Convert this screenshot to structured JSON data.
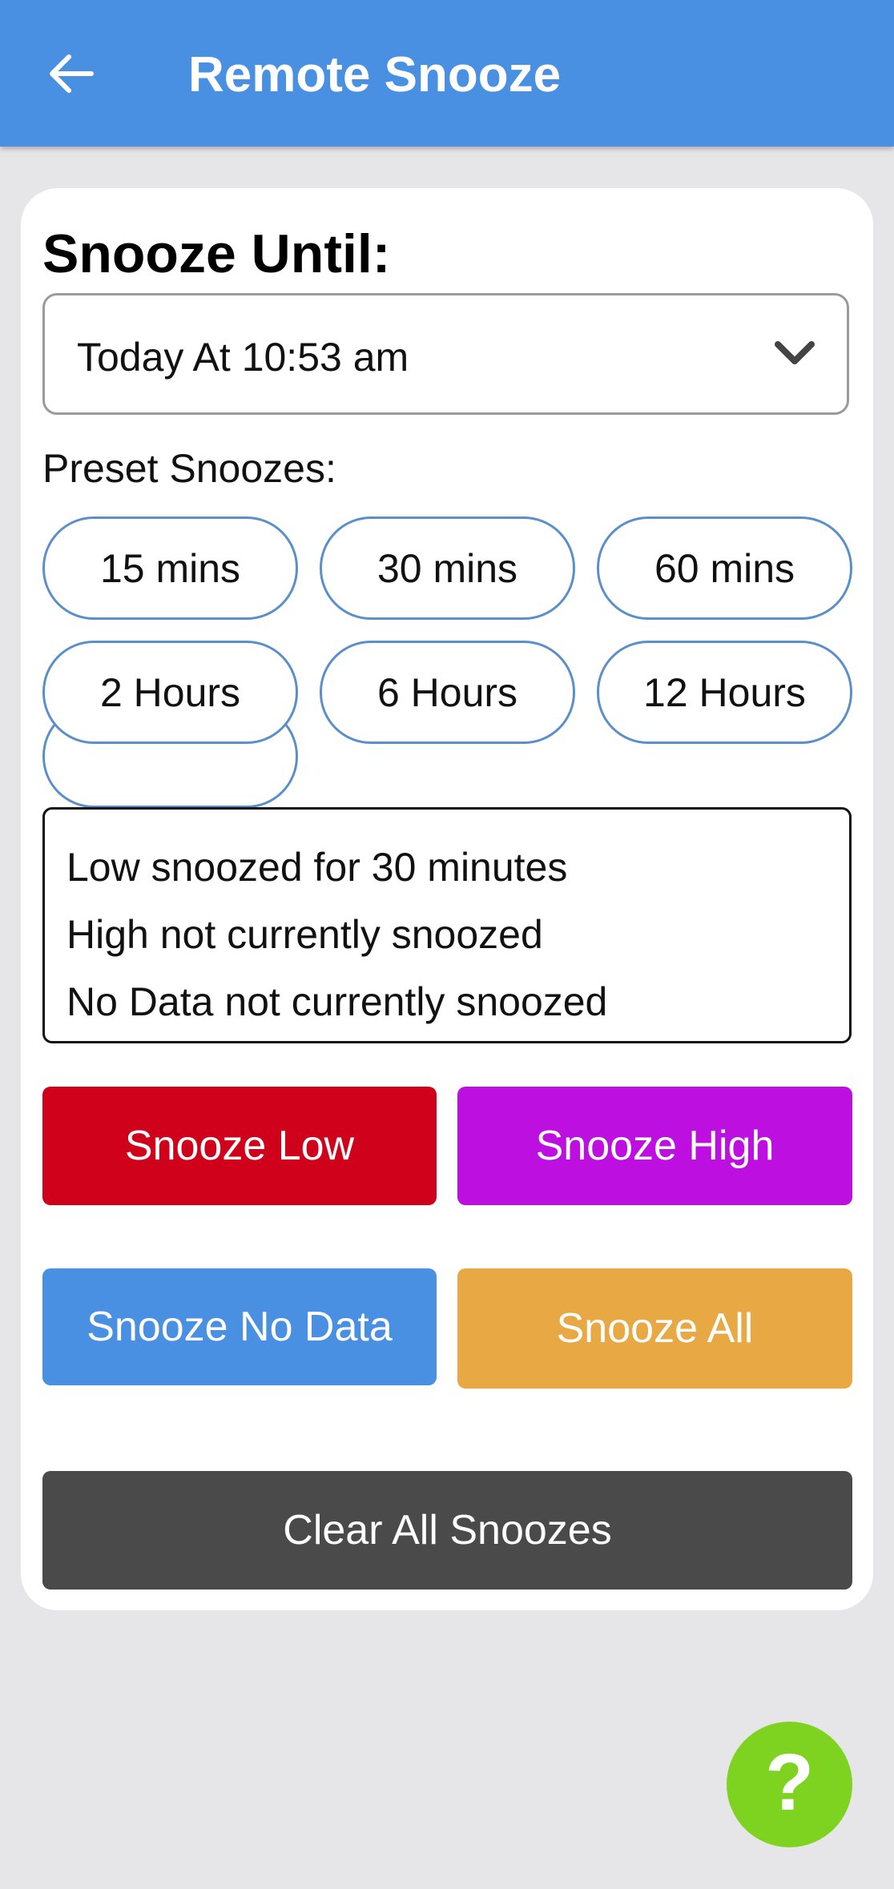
{
  "header": {
    "title": "Remote Snooze"
  },
  "snooze_until": {
    "title": "Snooze Until:",
    "selected": "Today At 10:53 am"
  },
  "presets": {
    "label": "Preset Snoozes:",
    "items": [
      "15 mins",
      "30 mins",
      "60 mins",
      "2 Hours",
      "6 Hours",
      "12 Hours"
    ]
  },
  "status": {
    "lines": [
      "Low snoozed for 30 minutes",
      "High not currently snoozed",
      "No Data not currently snoozed"
    ]
  },
  "actions": {
    "snooze_low": "Snooze Low",
    "snooze_high": "Snooze High",
    "snooze_no_data": "Snooze No Data",
    "snooze_all": "Snooze All",
    "clear_all": "Clear All Snoozes"
  },
  "colors": {
    "app_bar": "#4a90e2",
    "snooze_low": "#d0021b",
    "snooze_high": "#bd10e0",
    "snooze_no_data": "#4a90e2",
    "snooze_all": "#e8a945",
    "clear_all": "#4a4a4a",
    "help_fab": "#7ed321",
    "preset_border": "#5a8fc9"
  },
  "icons": {
    "back": "arrow-left-icon",
    "dropdown": "chevron-down-icon",
    "help": "question-mark-icon"
  }
}
